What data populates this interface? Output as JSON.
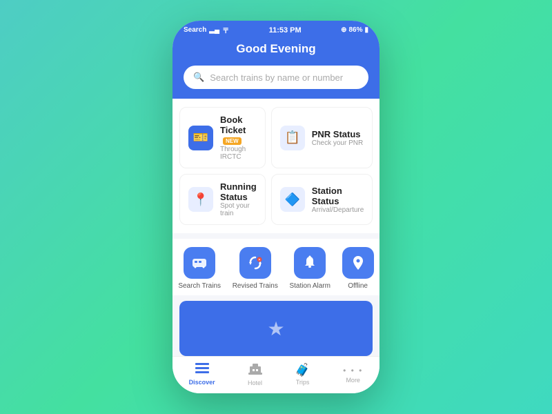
{
  "statusBar": {
    "left": "Search",
    "time": "11:53 PM",
    "battery": "86%"
  },
  "header": {
    "greeting": "Good Evening"
  },
  "search": {
    "placeholder": "Search trains by name or number"
  },
  "quickActions": [
    {
      "id": "book-ticket",
      "title": "Book Ticket",
      "subtitle": "Through IRCTC",
      "badge": "NEW",
      "iconType": "blue",
      "icon": "🎫"
    },
    {
      "id": "pnr-status",
      "title": "PNR Status",
      "subtitle": "Check your PNR",
      "badge": "",
      "iconType": "light-blue",
      "icon": "📋"
    },
    {
      "id": "running-status",
      "title": "Running Status",
      "subtitle": "Spot your train",
      "badge": "",
      "iconType": "light-blue",
      "icon": "📍"
    },
    {
      "id": "station-status",
      "title": "Station Status",
      "subtitle": "Arrival/Departure",
      "badge": "",
      "iconType": "light-blue",
      "icon": "🔷"
    }
  ],
  "shortcuts": [
    {
      "id": "search-trains",
      "label": "Search Trains",
      "icon": "🚂"
    },
    {
      "id": "revised-trains",
      "label": "Revised Trains",
      "icon": "🔄"
    },
    {
      "id": "station-alarm",
      "label": "Station Alarm",
      "icon": "🔔"
    },
    {
      "id": "offline",
      "label": "Offline",
      "icon": "📍"
    }
  ],
  "bottomNav": [
    {
      "id": "discover",
      "label": "Discover",
      "icon": "≡",
      "active": true
    },
    {
      "id": "hotel",
      "label": "Hotel",
      "icon": "⊞",
      "active": false
    },
    {
      "id": "trips",
      "label": "Trips",
      "icon": "🧳",
      "active": false
    },
    {
      "id": "more",
      "label": "More",
      "icon": "•••",
      "active": false
    }
  ]
}
